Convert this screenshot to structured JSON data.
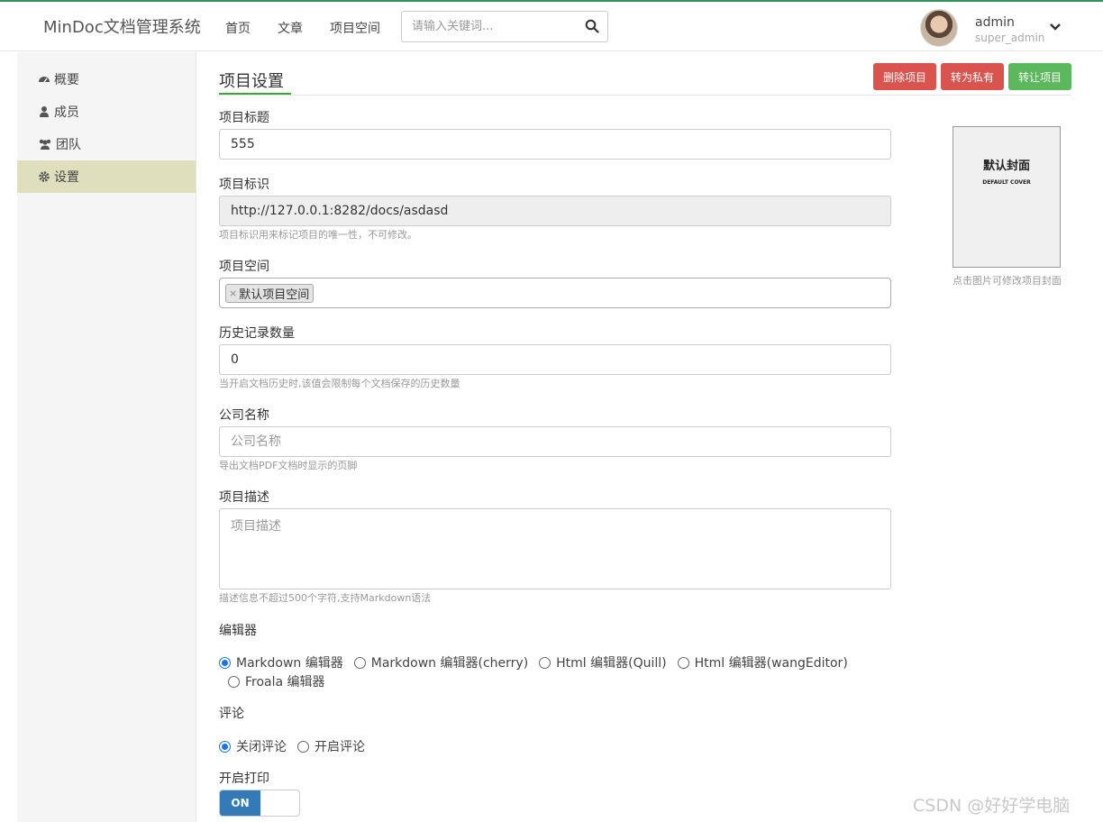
{
  "header": {
    "brand": "MinDoc文档管理系统",
    "nav": [
      "首页",
      "文章",
      "项目空间"
    ],
    "search_placeholder": "请输入关键词...",
    "user_name": "admin",
    "user_role": "super_admin"
  },
  "sidebar": {
    "items": [
      {
        "label": "概要",
        "icon": "dashboard-icon"
      },
      {
        "label": "成员",
        "icon": "user-icon"
      },
      {
        "label": "团队",
        "icon": "users-icon"
      },
      {
        "label": "设置",
        "icon": "gear-icon",
        "active": true
      }
    ]
  },
  "main": {
    "title": "项目设置",
    "actions": {
      "delete": "删除项目",
      "private": "转为私有",
      "transfer": "转让项目"
    },
    "form": {
      "title_label": "项目标题",
      "title_value": "555",
      "identifier_label": "项目标识",
      "identifier_value": "http://127.0.0.1:8282/docs/asdasd",
      "identifier_help": "项目标识用来标记项目的唯一性，不可修改。",
      "space_label": "项目空间",
      "space_tag": "默认项目空间",
      "space_tag_remove": "×",
      "history_label": "历史记录数量",
      "history_value": "0",
      "history_help": "当开启文档历史时,该值会限制每个文档保存的历史数量",
      "company_label": "公司名称",
      "company_placeholder": "公司名称",
      "company_help": "导出文档PDF文档时显示的页脚",
      "desc_label": "项目描述",
      "desc_placeholder": "项目描述",
      "desc_help": "描述信息不超过500个字符,支持Markdown语法",
      "editor_label": "编辑器",
      "editor_options": [
        "Markdown 编辑器",
        "Markdown 编辑器(cherry)",
        "Html 编辑器(Quill)",
        "Html 编辑器(wangEditor)",
        "Froala 编辑器"
      ],
      "editor_selected": "Markdown 编辑器",
      "comment_label": "评论",
      "comment_options": [
        "关闭评论",
        "开启评论"
      ],
      "comment_selected": "关闭评论",
      "print_label": "开启打印",
      "print_toggle": "ON"
    },
    "cover": {
      "title": "默认封面",
      "subtitle": "DEFAULT COVER",
      "hint": "点击图片可修改项目封面"
    }
  },
  "watermark": "CSDN @好好学电脑",
  "colors": {
    "accent_green": "#5cb85c",
    "danger_red": "#d9534f",
    "primary_blue": "#337ab7",
    "sidebar_active": "#e0dfbd"
  }
}
